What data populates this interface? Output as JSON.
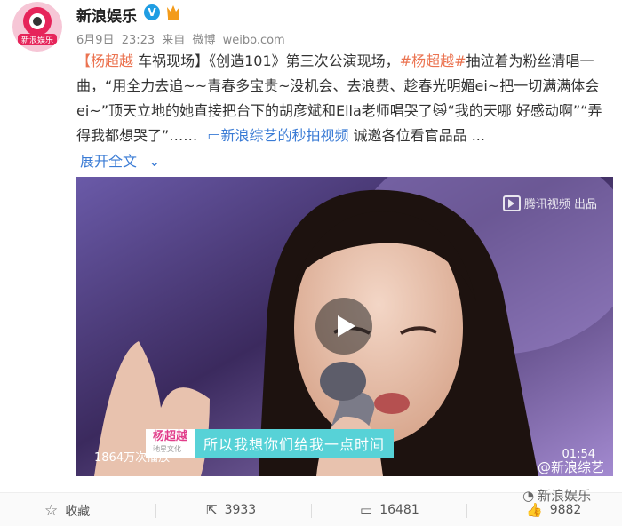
{
  "header": {
    "username": "新浪娱乐",
    "verified_badge": "V",
    "member_icon": "member-crown-icon",
    "date": "6月9日",
    "time": "23:23",
    "source_prefix": "来自",
    "source": "微博",
    "source_url": "weibo.com"
  },
  "post": {
    "topic": "【杨超越",
    "topic_rest": " 车祸现场】",
    "text1": "《创造101》第三次公演现场，",
    "hashtag": "#杨超越#",
    "text2": "抽泣着为粉丝清唱一曲，“用全力去追~~青春多宝贵~没机会、去浪费、趁春光明媚ei~把一切满满体会ei~”顶天立地的她直接把台下的胡彦斌和Ella老师唱哭了",
    "text3": "“我的天哪 好感动啊”“弄得我都想哭了”……",
    "video_link": "新浪综艺的秒拍视频",
    "text4": " 诚邀各位看官品品 ...",
    "expand_label": "展开全文"
  },
  "video": {
    "watermark_top": "腾讯视频 出品",
    "name_tag": "杨超越",
    "name_sub": "驰星文化",
    "subtitle": "所以我想你们给我一点时间",
    "views": "1864万次播放",
    "duration": "01:54",
    "watermark_bottom": "@新浪综艺"
  },
  "actions": {
    "favorite": "收藏",
    "repost": "3933",
    "comment": "16481",
    "like": "9882"
  },
  "footer_watermark": "新浪娱乐"
}
